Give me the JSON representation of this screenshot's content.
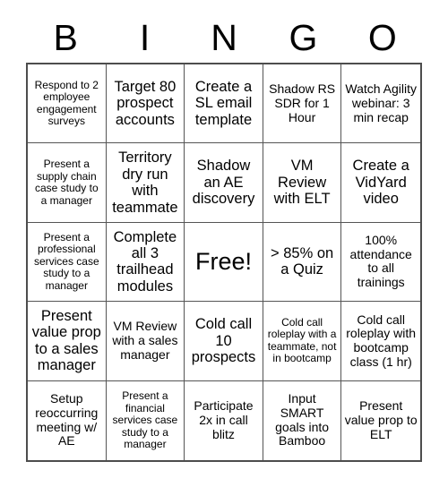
{
  "card": {
    "title": "BINGO",
    "header_letters": [
      "B",
      "I",
      "N",
      "G",
      "O"
    ],
    "grid_size": 5,
    "free_space_index": 12,
    "colors": {
      "background": "#ffffff",
      "text": "#000000",
      "grid_line": "#555555",
      "outer_border": "#4d4d4d"
    },
    "cells": [
      {
        "text": "Respond to 2 employee engagement surveys",
        "size": "s"
      },
      {
        "text": "Target 80 prospect accounts",
        "size": "l"
      },
      {
        "text": "Create a SL email template",
        "size": "l"
      },
      {
        "text": "Shadow RS SDR for 1 Hour",
        "size": "m"
      },
      {
        "text": "Watch Agility webinar: 3 min recap",
        "size": "m"
      },
      {
        "text": "Present a supply chain case study to a manager",
        "size": "s"
      },
      {
        "text": "Territory dry run with teammate",
        "size": "l"
      },
      {
        "text": "Shadow an AE discovery",
        "size": "l"
      },
      {
        "text": "VM Review with ELT",
        "size": "l"
      },
      {
        "text": "Create a VidYard video",
        "size": "l"
      },
      {
        "text": "Present a professional services case study to a manager",
        "size": "s"
      },
      {
        "text": "Complete all 3 trailhead modules",
        "size": "l"
      },
      {
        "text": "Free!",
        "size": "xl"
      },
      {
        "text": "> 85% on a Quiz",
        "size": "l"
      },
      {
        "text": "100% attendance to all trainings",
        "size": "m"
      },
      {
        "text": "Present value prop to a sales manager",
        "size": "l"
      },
      {
        "text": "VM Review with a sales manager",
        "size": "m"
      },
      {
        "text": "Cold call 10 prospects",
        "size": "l"
      },
      {
        "text": "Cold call roleplay with a teammate, not in bootcamp",
        "size": "s"
      },
      {
        "text": "Cold call roleplay with bootcamp class (1 hr)",
        "size": "m"
      },
      {
        "text": "Setup reoccurring meeting w/ AE",
        "size": "m"
      },
      {
        "text": "Present a financial services case study to a manager",
        "size": "s"
      },
      {
        "text": "Participate 2x in call blitz",
        "size": "m"
      },
      {
        "text": "Input SMART goals into Bamboo",
        "size": "m"
      },
      {
        "text": "Present value prop to ELT",
        "size": "m"
      }
    ]
  }
}
